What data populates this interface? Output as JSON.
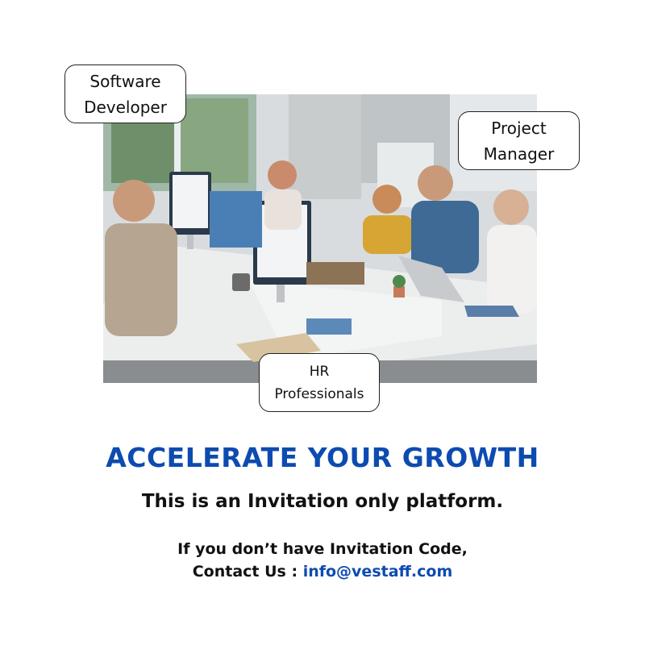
{
  "image": {
    "description_icon": "office-team-photo"
  },
  "badges": {
    "software_developer": [
      "Software",
      "Developer"
    ],
    "project_manager": [
      "Project",
      "Manager"
    ],
    "hr_professionals": [
      "HR",
      "Professionals"
    ]
  },
  "headline": "ACCELERATE YOUR GROWTH",
  "subheadline": "This is an Invitation only platform.",
  "contact": {
    "line1": "If you don’t have Invitation Code,",
    "prefix": "Contact Us : ",
    "email": "info@vestaff.com"
  },
  "colors": {
    "accent": "#0d4bb0",
    "text": "#111111"
  }
}
